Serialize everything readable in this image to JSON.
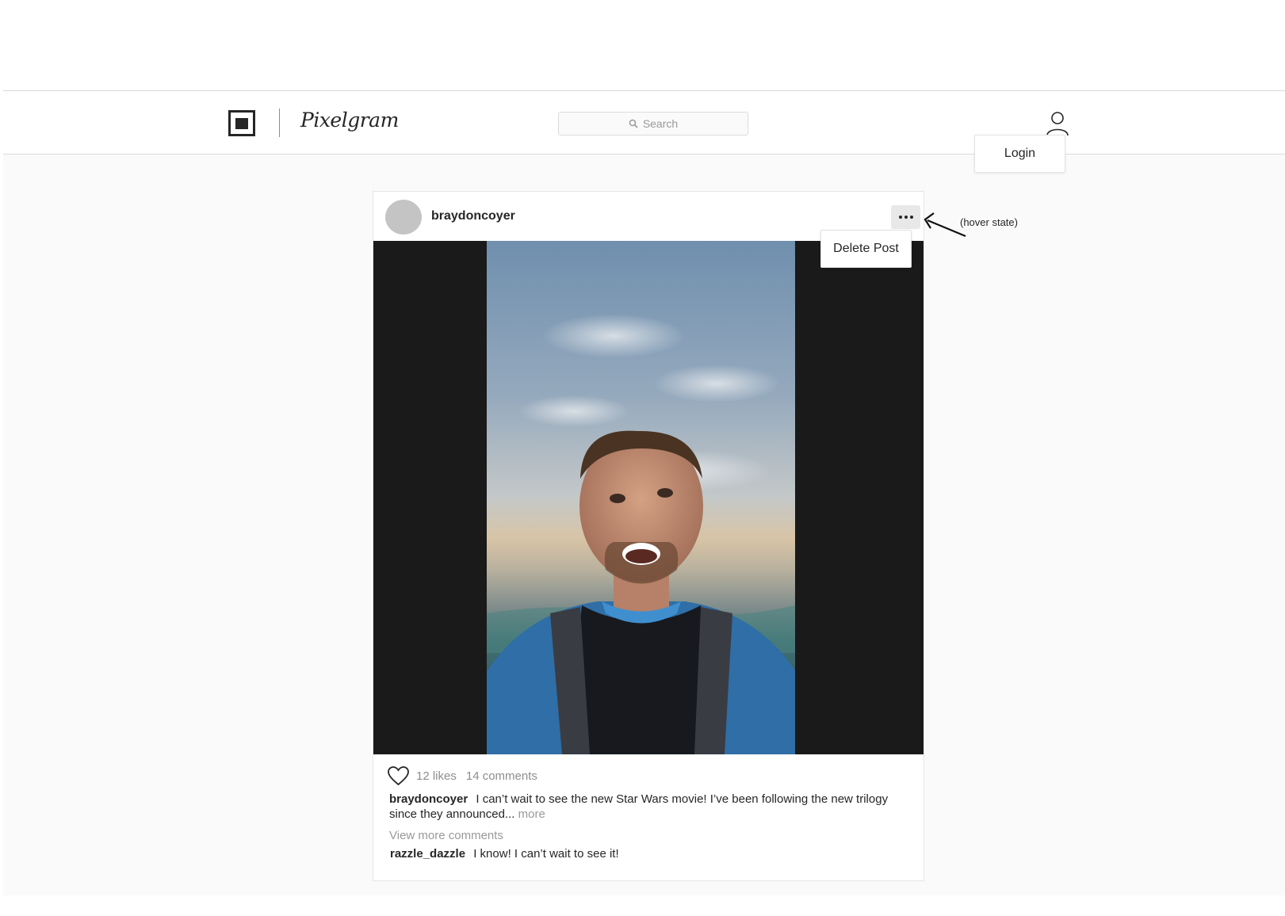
{
  "app": {
    "brand": "Pixelgram"
  },
  "header": {
    "search_placeholder": "Search",
    "login_label": "Login"
  },
  "post": {
    "username": "braydoncoyer",
    "menu": {
      "delete_label": "Delete Post"
    },
    "likes_text": "12 likes",
    "comments_text": "14 comments",
    "caption": {
      "username": "braydoncoyer",
      "text": "I can’t wait to see the new Star Wars movie! I’ve been following the new trilogy since they announced...",
      "more_label": "more"
    },
    "view_more_label": "View more comments",
    "comments": [
      {
        "username": "razzle_dazzle",
        "text": "I know! I can’t wait to see it!"
      }
    ]
  },
  "annotation": {
    "text": "(hover state)"
  },
  "icons": {
    "logo": "logo-square-icon",
    "search": "search-icon",
    "user": "user-icon",
    "more": "more-horizontal-icon",
    "like": "heart-icon",
    "arrow": "arrow-left-icon"
  },
  "colors": {
    "background": "#fafafa",
    "surface": "#ffffff",
    "text": "#262626",
    "muted": "#8e8e8e",
    "avatar": "#c4c4c4",
    "media_letterbox": "#1a1a1a"
  }
}
